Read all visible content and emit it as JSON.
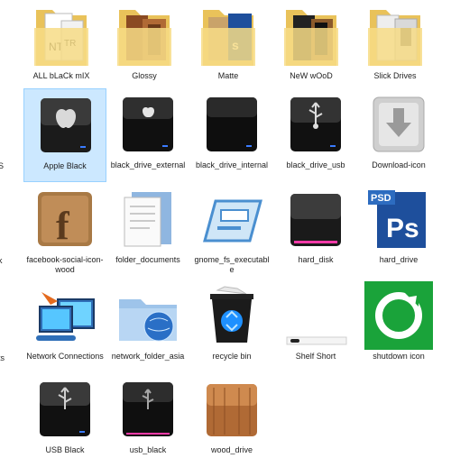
{
  "rows": [
    [
      {
        "label": "ALL bLaCk mIX",
        "icon": "folder-icon"
      },
      {
        "label": "Glossy",
        "icon": "folder-icon"
      },
      {
        "label": "Matte",
        "icon": "folder-icon"
      },
      {
        "label": "NeW wOoD",
        "icon": "folder-icon"
      },
      {
        "label": "Slick Drives",
        "icon": "folder-icon"
      }
    ],
    [
      {
        "label": "Apple Black",
        "icon": "apple-drive-icon",
        "selected": true
      },
      {
        "label": "black_drive_external",
        "icon": "apple-drive-icon"
      },
      {
        "label": "black_drive_internal",
        "icon": "black-drive-icon"
      },
      {
        "label": "black_drive_usb",
        "icon": "usb-drive-icon"
      },
      {
        "label": "Download-icon",
        "icon": "download-icon"
      }
    ],
    [
      {
        "label": "facebook-social-icon-wood",
        "icon": "facebook-wood-icon"
      },
      {
        "label": "folder_documents",
        "icon": "documents-folder-icon"
      },
      {
        "label": "gnome_fs_executable",
        "icon": "executable-icon"
      },
      {
        "label": "hard_disk",
        "icon": "hard-disk-icon"
      },
      {
        "label": "hard_drive",
        "icon": "photoshop-icon"
      }
    ],
    [
      {
        "label": "Network Connections",
        "icon": "network-connections-icon"
      },
      {
        "label": "network_folder_asia",
        "icon": "network-folder-icon"
      },
      {
        "label": "recycle bin",
        "icon": "recycle-bin-icon"
      },
      {
        "label": "Shelf Short",
        "icon": "shelf-icon"
      },
      {
        "label": "shutdown icon",
        "icon": "shutdown-icon"
      }
    ],
    [
      {
        "label": "USB Black",
        "icon": "usb-drive-icon"
      },
      {
        "label": "usb_black",
        "icon": "usb-drive-icon"
      },
      {
        "label": "wood_drive",
        "icon": "wood-drive-icon"
      }
    ]
  ],
  "left_edge_labels": [
    "S",
    "k",
    "ts"
  ],
  "colors": {
    "selection_bg": "#cce8ff",
    "selection_border": "#99d1ff",
    "folder_yellow": "#f5d77a",
    "shutdown_green": "#1aa33a",
    "psd_blue": "#1e4f9c",
    "drive_led": "#3a7bff"
  }
}
